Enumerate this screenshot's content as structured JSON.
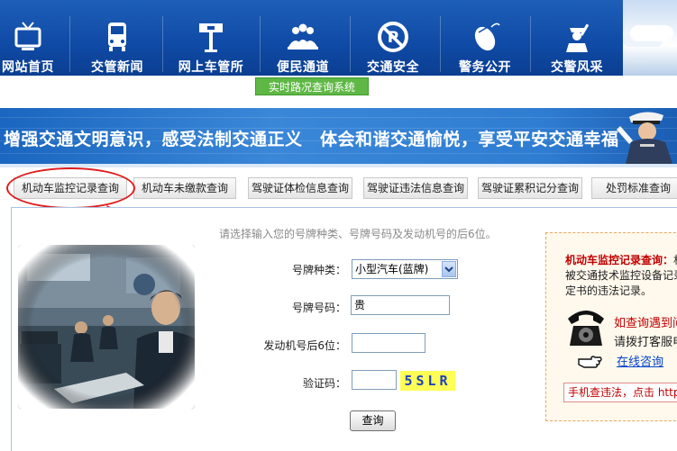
{
  "nav": {
    "items": [
      {
        "label": "网站首页",
        "icon": "tv-icon"
      },
      {
        "label": "交管新闻",
        "icon": "bus-icon"
      },
      {
        "label": "网上车管所",
        "icon": "signpost-icon"
      },
      {
        "label": "便民通道",
        "icon": "people-icon"
      },
      {
        "label": "交通安全",
        "icon": "no-parking-icon"
      },
      {
        "label": "警务公开",
        "icon": "mouse-icon"
      },
      {
        "label": "交警风采",
        "icon": "police-icon"
      }
    ],
    "realtime_label": "实时路况查询系统"
  },
  "banner": {
    "slogan": "增强交通文明意识，感受法制交通正义　体会和谐交通愉悦，享受平安交通幸福"
  },
  "tabs": [
    "机动车监控记录查询",
    "机动车未缴款查询",
    "驾驶证体检信息查询",
    "驾驶证违法信息查询",
    "驾驶证累积记分查询",
    "处罚标准查询"
  ],
  "form": {
    "hint": "请选择输入您的号牌种类、号牌号码及发动机号的后6位。",
    "plate_type_label": "号牌种类：",
    "plate_type_value": "小型汽车(蓝牌)",
    "plate_number_label": "号牌号码：",
    "plate_number_value": "贵",
    "engine_label": "发动机号后6位：",
    "engine_value": "",
    "captcha_label": "验证码：",
    "captcha_value": "",
    "captcha_text": "5SLR",
    "submit_label": "查询"
  },
  "info": {
    "title": "机动车监控记录查询：",
    "title_tail": "机",
    "line2": "被交通技术监控设备记录",
    "line3": "定书的违法记录。",
    "consult_red": "如查询遇到问",
    "consult_text": "请拨打客服电",
    "online_link": "在线咨询",
    "mobile_text": "手机查违法，点击 http"
  },
  "colors": {
    "nav_bg": "#0f4aa5",
    "realtime_bg": "#5fb845",
    "banner_bg": "#2f7dd2",
    "highlight_circle": "#e01b1b",
    "info_red": "#c00000",
    "captcha_bg": "#ffff55"
  }
}
